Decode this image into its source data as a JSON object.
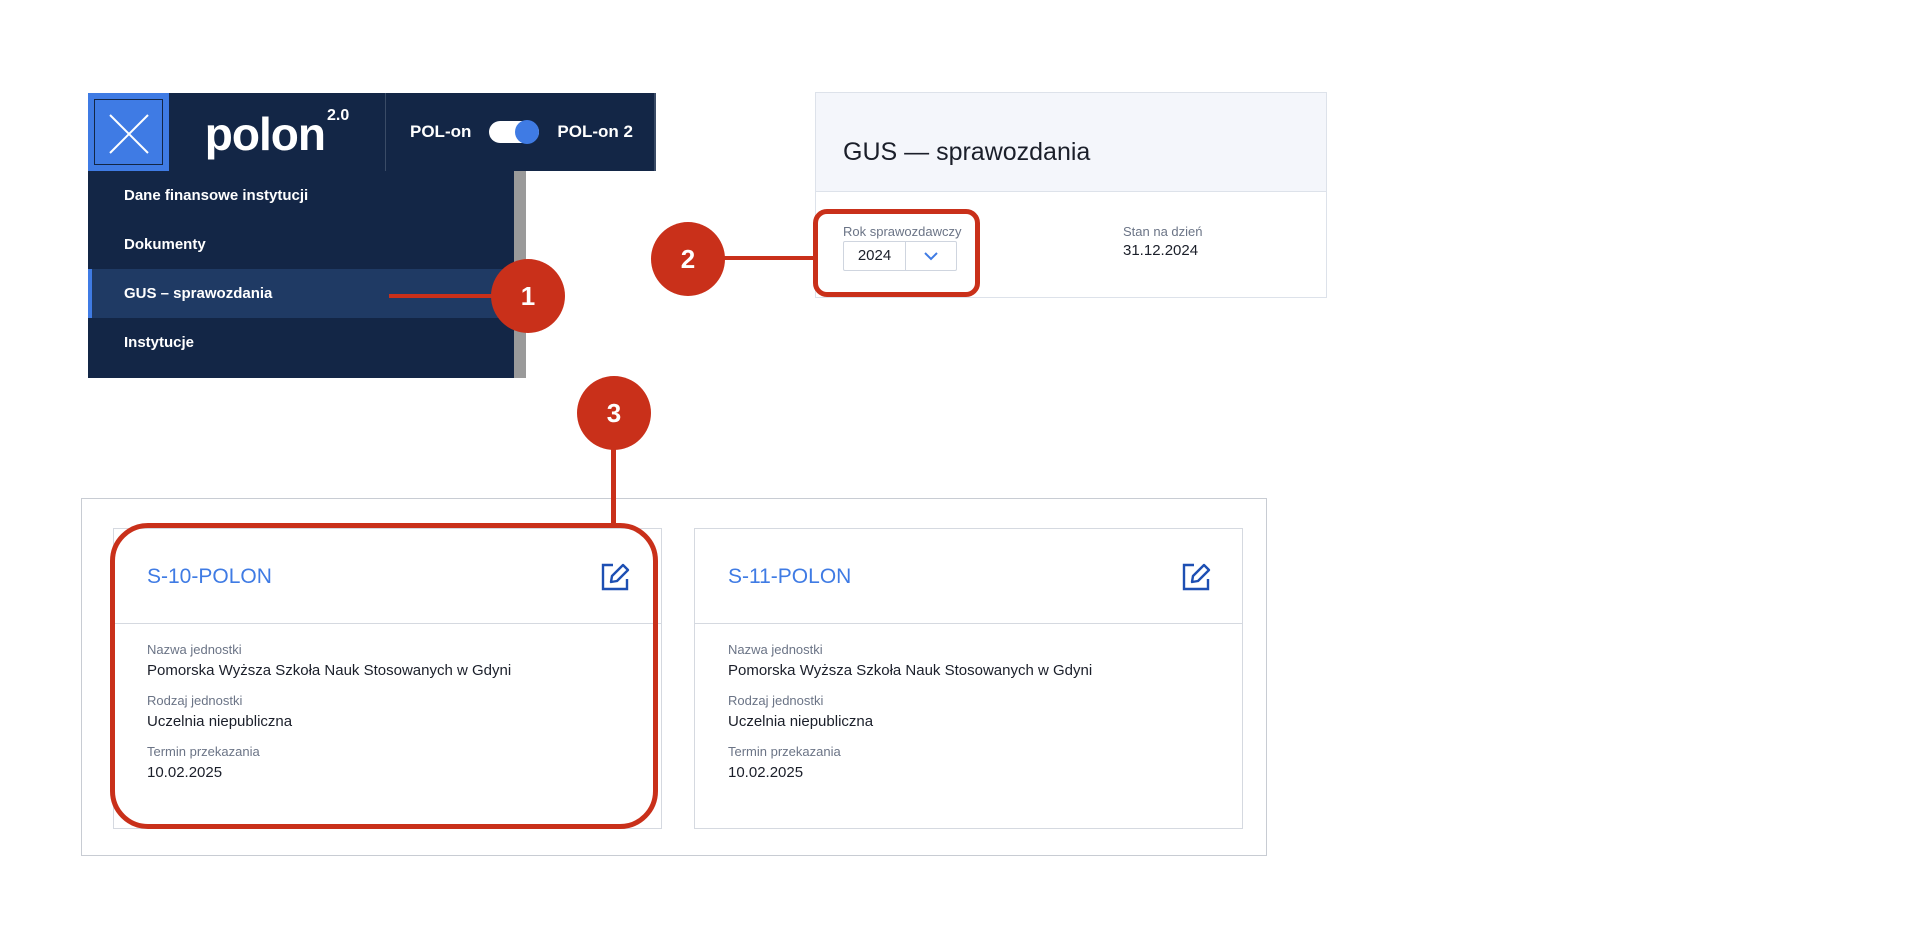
{
  "nav": {
    "logo_word": "polon",
    "logo_version": "2.0",
    "toggle_left": "POL-on",
    "toggle_right": "POL-on 2",
    "toggle_state": "POL-on 2",
    "items": [
      {
        "label": "Dane finansowe instytucji"
      },
      {
        "label": "Dokumenty"
      },
      {
        "label": "GUS – sprawozdania"
      },
      {
        "label": "Instytucje"
      }
    ],
    "active_item": "GUS – sprawozdania"
  },
  "gus": {
    "title": "GUS — sprawozdania",
    "year_label": "Rok sprawozdawczy",
    "year_value": "2024",
    "date_label": "Stan na dzień",
    "date_value": "31.12.2024"
  },
  "cards": [
    {
      "title": "S-10-POLON",
      "unit_name_label": "Nazwa jednostki",
      "unit_name": "Pomorska Wyższa Szkoła Nauk Stosowanych w Gdyni",
      "unit_type_label": "Rodzaj jednostki",
      "unit_type": "Uczelnia niepubliczna",
      "deadline_label": "Termin przekazania",
      "deadline": "10.02.2025"
    },
    {
      "title": "S-11-POLON",
      "unit_name_label": "Nazwa jednostki",
      "unit_name": "Pomorska Wyższa Szkoła Nauk Stosowanych w Gdyni",
      "unit_type_label": "Rodzaj jednostki",
      "unit_type": "Uczelnia niepubliczna",
      "deadline_label": "Termin przekazania",
      "deadline": "10.02.2025"
    }
  ],
  "callouts": [
    "1",
    "2",
    "3"
  ],
  "colors": {
    "nav_bg": "#132646",
    "accent_blue": "#3f7be4",
    "callout_red": "#c9301a"
  },
  "icons": [
    "close-icon",
    "chevron-down-icon",
    "edit-icon"
  ]
}
